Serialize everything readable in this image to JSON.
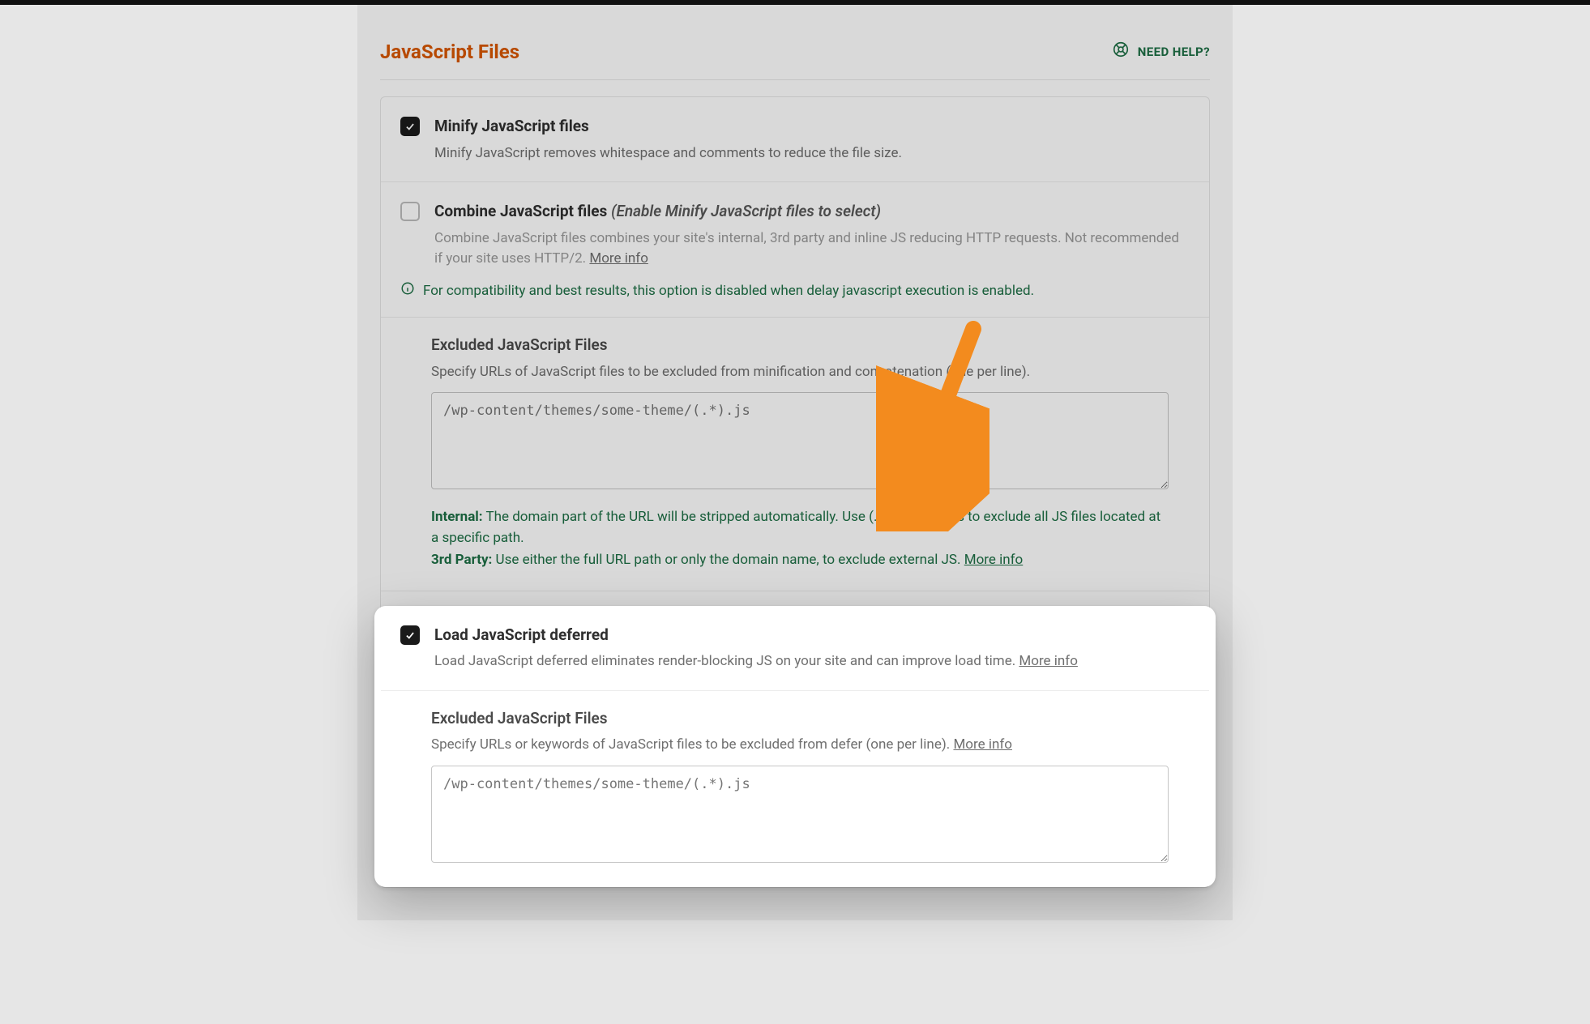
{
  "header": {
    "title": "JavaScript Files",
    "help_label": "NEED HELP?"
  },
  "minify": {
    "title": "Minify JavaScript files",
    "desc": "Minify JavaScript removes whitespace and comments to reduce the file size."
  },
  "combine": {
    "title": "Combine JavaScript files",
    "hint": "(Enable Minify JavaScript files to select)",
    "desc": "Combine JavaScript files combines your site's internal, 3rd party and inline JS reducing HTTP requests. Not recommended if your site uses HTTP/2.",
    "more": "More info",
    "note": "For compatibility and best results, this option is disabled when delay javascript execution is enabled."
  },
  "excluded1": {
    "title": "Excluded JavaScript Files",
    "desc": "Specify URLs of JavaScript files to be excluded from minification and concatenation (one per line).",
    "placeholder": "/wp-content/themes/some-theme/(.*).js",
    "tip_internal_label": "Internal:",
    "tip_internal": " The domain part of the URL will be stripped automatically. Use (.*).js wildcards to exclude all JS files located at a specific path.",
    "tip_3rd_label": "3rd Party:",
    "tip_3rd": " Use either the full URL path or only the domain name, to exclude external JS.",
    "tip_more": "More info"
  },
  "defer": {
    "title": "Load JavaScript deferred",
    "desc": "Load JavaScript deferred eliminates render-blocking JS on your site and can improve load time.",
    "more": "More info"
  },
  "excluded2": {
    "title": "Excluded JavaScript Files",
    "desc": "Specify URLs or keywords of JavaScript files to be excluded from defer (one per line).",
    "more": "More info",
    "placeholder": "/wp-content/themes/some-theme/(.*).js"
  }
}
